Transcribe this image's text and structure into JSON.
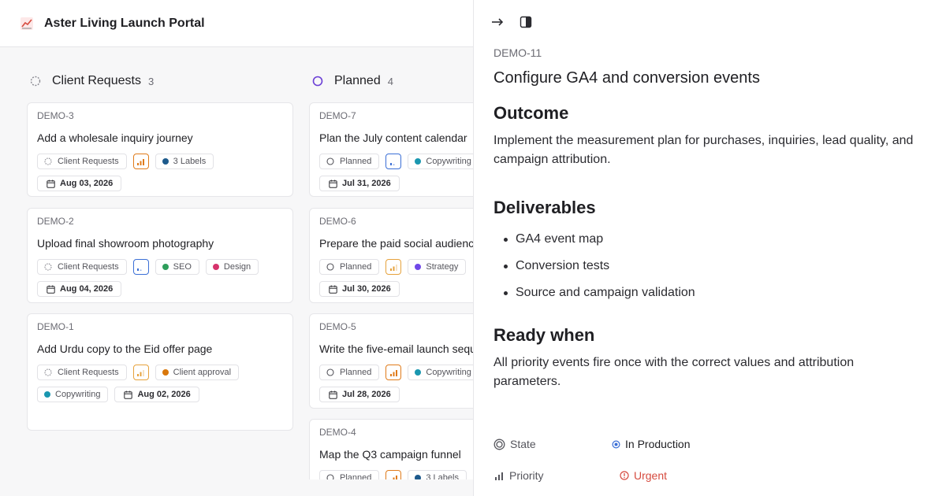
{
  "app": {
    "title": "Aster Living Launch Portal"
  },
  "columns": [
    {
      "name": "Client Requests",
      "count": "3",
      "cards": [
        {
          "id": "DEMO-3",
          "title": "Add a wholesale inquiry journey",
          "status": "Client Requests",
          "labels": [
            "3 Labels"
          ],
          "date": "Aug 03, 2026"
        },
        {
          "id": "DEMO-2",
          "title": "Upload final showroom photography",
          "status": "Client Requests",
          "labels": [
            "SEO",
            "Design"
          ],
          "date": "Aug 04, 2026"
        },
        {
          "id": "DEMO-1",
          "title": "Add Urdu copy to the Eid offer page",
          "status": "Client Requests",
          "labels": [
            "Client approval",
            "Copywriting"
          ],
          "date": "Aug 02, 2026"
        }
      ]
    },
    {
      "name": "Planned",
      "count": "4",
      "cards": [
        {
          "id": "DEMO-7",
          "title": "Plan the July content calendar",
          "status": "Planned",
          "labels": [
            "Copywriting"
          ],
          "date": "Jul 31, 2026"
        },
        {
          "id": "DEMO-6",
          "title": "Prepare the paid social audiences",
          "status": "Planned",
          "labels": [
            "Strategy"
          ],
          "date": "Jul 30, 2026"
        },
        {
          "id": "DEMO-5",
          "title": "Write the five-email launch sequence",
          "status": "Planned",
          "labels": [
            "Copywriting"
          ],
          "date": "Jul 28, 2026"
        },
        {
          "id": "DEMO-4",
          "title": "Map the Q3 campaign funnel",
          "status": "Planned",
          "labels": [
            "3 Labels"
          ],
          "date": ""
        }
      ]
    }
  ],
  "panel": {
    "id": "DEMO-11",
    "title": "Configure GA4 and conversion events",
    "outcome_heading": "Outcome",
    "outcome_text": "Implement the measurement plan for purchases, inquiries, lead quality, and campaign attribution.",
    "deliverables_heading": "Deliverables",
    "deliverables": [
      "GA4 event map",
      "Conversion tests",
      "Source and campaign validation"
    ],
    "ready_heading": "Ready when",
    "ready_text": "All priority events fire once with the correct values and attribution parameters.",
    "props": {
      "state_label": "State",
      "state_value": "In Production",
      "priority_label": "Priority",
      "priority_value": "Urgent"
    }
  },
  "colors": {
    "planned": "#6b3fd6",
    "urgent": "#d64b3f",
    "in_production": "#3b6fd6",
    "label_blue": "#1d5a8c",
    "label_seo": "#2e9e5b",
    "label_design": "#d6336c",
    "label_copy": "#1a97b0",
    "label_strategy": "#7048e8",
    "label_approval": "#d9770b",
    "prio_high": "#e07b1a",
    "prio_med": "#e6a23c",
    "prio_low": "#3b6fd6"
  }
}
